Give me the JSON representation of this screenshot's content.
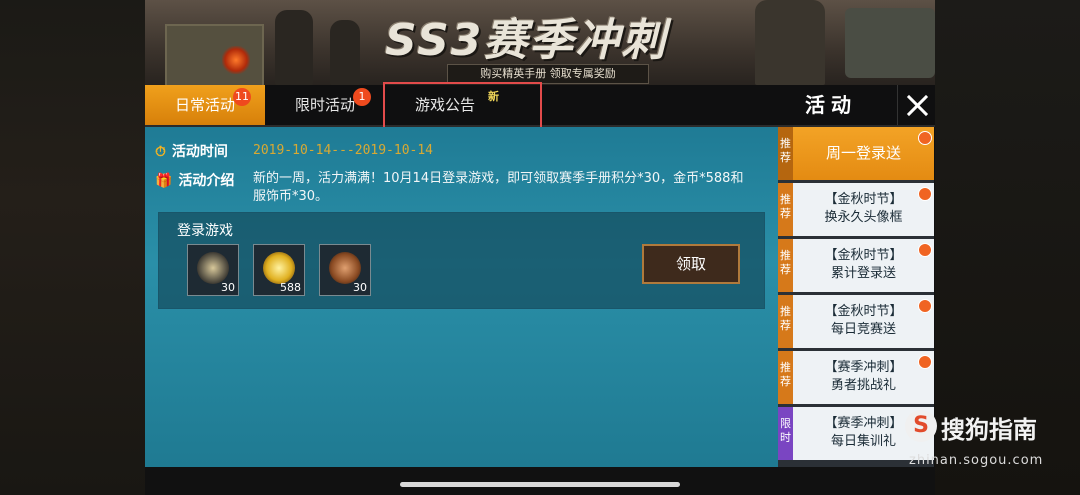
{
  "banner": {
    "title": "SS3赛季冲刺",
    "subtitle": "购买精英手册  领取专属奖励"
  },
  "tabs": [
    {
      "label": "日常活动",
      "badge": "11"
    },
    {
      "label": "限时活动",
      "badge": "1"
    },
    {
      "label": "游戏公告",
      "new_tag": "新"
    }
  ],
  "panel_title": "活动",
  "detail": {
    "time_label": "活动时间",
    "time_value": "2019-10-14---2019-10-14",
    "intro_label": "活动介绍",
    "intro_text": "新的一周，活力满满！10月14日登录游戏，即可领取赛季手册积分*30，金币*588和服饰币*30。",
    "task_title": "登录游戏",
    "rewards": [
      {
        "icon": "medal-star-icon",
        "count": "30"
      },
      {
        "icon": "gold-coin-icon",
        "count": "588"
      },
      {
        "icon": "outfit-coin-icon",
        "count": "30"
      }
    ],
    "claim_label": "领取"
  },
  "activities": [
    {
      "tag": "推荐",
      "line1": "周一登录送",
      "line2": "",
      "selected": true
    },
    {
      "tag": "推荐",
      "line1": "【金秋时节】",
      "line2": "换永久头像框"
    },
    {
      "tag": "推荐",
      "line1": "【金秋时节】",
      "line2": "累计登录送"
    },
    {
      "tag": "推荐",
      "line1": "【金秋时节】",
      "line2": "每日竞赛送"
    },
    {
      "tag": "推荐",
      "line1": "【赛季冲刺】",
      "line2": "勇者挑战礼"
    },
    {
      "tag": "限时",
      "line1": "【赛季冲刺】",
      "line2": "每日集训礼"
    }
  ],
  "watermark": {
    "text": "搜狗指南",
    "url": "zhinan.sogou.com"
  },
  "colors": {
    "accent": "#e48b12",
    "highlight": "#e24b4b",
    "content_bg": "#2a8fa8"
  }
}
